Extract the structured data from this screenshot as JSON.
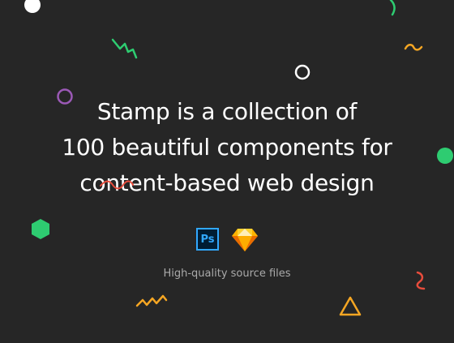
{
  "headline": {
    "line1": "Stamp is a collection of",
    "line2": "100 beautiful components for",
    "line3": "content-based web design"
  },
  "apps": [
    {
      "name": "photoshop-icon",
      "label": "Ps",
      "color": "#31a8ff"
    },
    {
      "name": "sketch-icon",
      "color": "#fdb300"
    }
  ],
  "tagline": "High-quality source files",
  "colors": {
    "background": "#262626",
    "text": "#ffffff",
    "muted": "#aaaaaa",
    "green": "#2ecc71",
    "orange": "#f5a623",
    "red": "#e74c3c",
    "purple": "#9b59b6"
  }
}
